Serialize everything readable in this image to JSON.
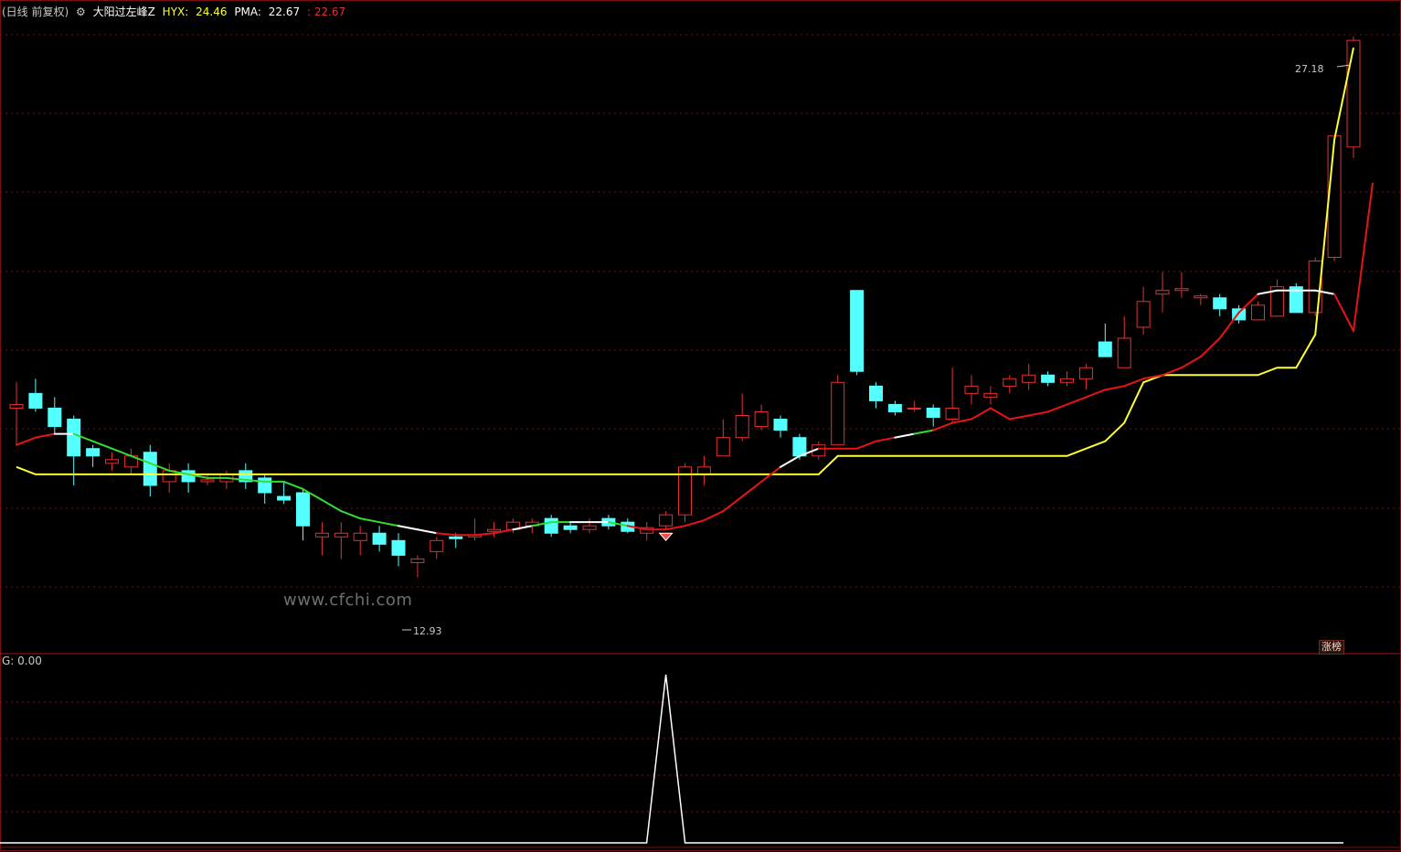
{
  "header": {
    "period": "(日线 前复权)",
    "indicator": "大阳过左峰Z",
    "hyx_label": "HYX:",
    "hyx_value": "24.46",
    "pma_label": "PMA:",
    "pma_value": "22.67",
    "pma_value2": ": 22.67"
  },
  "sub_header": {
    "label": "G: 0.00"
  },
  "badge": {
    "label": "涨榜"
  },
  "watermark": "www.cfchi.com",
  "annotations": {
    "high": "27.18",
    "low": "12.93"
  },
  "colors": {
    "up": "#e63030",
    "down": "#54ffff",
    "hyx": "#ffff33",
    "pma_up": "#e61414",
    "pma_down": "#33dd33",
    "pma_flat": "#ffffff",
    "grid": "#7a1010",
    "signal": "#ffffff"
  },
  "chart_data": {
    "type": "candlestick",
    "price_axis": {
      "min": 12.3,
      "max": 29.5
    },
    "candles": [
      {
        "o": 19.0,
        "h": 19.6,
        "l": 17.9,
        "c": 18.9,
        "dir": "up"
      },
      {
        "o": 19.3,
        "h": 19.7,
        "l": 18.8,
        "c": 18.9,
        "dir": "down"
      },
      {
        "o": 18.9,
        "h": 19.2,
        "l": 18.2,
        "c": 18.4,
        "dir": "down"
      },
      {
        "o": 18.6,
        "h": 18.7,
        "l": 16.8,
        "c": 17.6,
        "dir": "down"
      },
      {
        "o": 17.8,
        "h": 17.9,
        "l": 17.3,
        "c": 17.6,
        "dir": "down"
      },
      {
        "o": 17.4,
        "h": 17.7,
        "l": 17.2,
        "c": 17.5,
        "dir": "up"
      },
      {
        "o": 17.3,
        "h": 17.8,
        "l": 17.1,
        "c": 17.6,
        "dir": "up"
      },
      {
        "o": 17.7,
        "h": 17.9,
        "l": 16.5,
        "c": 16.8,
        "dir": "down"
      },
      {
        "o": 16.9,
        "h": 17.4,
        "l": 16.6,
        "c": 17.2,
        "dir": "up"
      },
      {
        "o": 17.2,
        "h": 17.4,
        "l": 16.6,
        "c": 16.9,
        "dir": "down"
      },
      {
        "o": 16.9,
        "h": 17.1,
        "l": 16.8,
        "c": 16.95,
        "dir": "up"
      },
      {
        "o": 16.9,
        "h": 17.2,
        "l": 16.7,
        "c": 17.1,
        "dir": "up"
      },
      {
        "o": 17.2,
        "h": 17.4,
        "l": 16.7,
        "c": 16.9,
        "dir": "down"
      },
      {
        "o": 17.0,
        "h": 17.1,
        "l": 16.3,
        "c": 16.6,
        "dir": "down"
      },
      {
        "o": 16.5,
        "h": 16.9,
        "l": 16.3,
        "c": 16.4,
        "dir": "down"
      },
      {
        "o": 16.6,
        "h": 16.7,
        "l": 15.3,
        "c": 15.7,
        "dir": "down"
      },
      {
        "o": 15.4,
        "h": 15.8,
        "l": 14.9,
        "c": 15.5,
        "dir": "up"
      },
      {
        "o": 15.5,
        "h": 15.8,
        "l": 14.8,
        "c": 15.4,
        "dir": "up"
      },
      {
        "o": 15.3,
        "h": 15.7,
        "l": 14.9,
        "c": 15.5,
        "dir": "up"
      },
      {
        "o": 15.5,
        "h": 15.7,
        "l": 15.0,
        "c": 15.2,
        "dir": "down"
      },
      {
        "o": 15.3,
        "h": 15.5,
        "l": 14.6,
        "c": 14.9,
        "dir": "down"
      },
      {
        "o": 14.7,
        "h": 14.9,
        "l": 14.3,
        "c": 14.8,
        "dir": "up"
      },
      {
        "o": 15.0,
        "h": 15.4,
        "l": 14.8,
        "c": 15.3,
        "dir": "up"
      },
      {
        "o": 15.4,
        "h": 15.5,
        "l": 15.1,
        "c": 15.35,
        "dir": "down"
      },
      {
        "o": 15.4,
        "h": 15.9,
        "l": 15.3,
        "c": 15.45,
        "dir": "up"
      },
      {
        "o": 15.55,
        "h": 15.8,
        "l": 15.4,
        "c": 15.6,
        "dir": "up"
      },
      {
        "o": 15.6,
        "h": 15.9,
        "l": 15.5,
        "c": 15.8,
        "dir": "up"
      },
      {
        "o": 15.7,
        "h": 15.9,
        "l": 15.5,
        "c": 15.8,
        "dir": "up"
      },
      {
        "o": 15.9,
        "h": 16.0,
        "l": 15.4,
        "c": 15.5,
        "dir": "down"
      },
      {
        "o": 15.7,
        "h": 15.8,
        "l": 15.5,
        "c": 15.6,
        "dir": "down"
      },
      {
        "o": 15.6,
        "h": 15.9,
        "l": 15.5,
        "c": 15.7,
        "dir": "up"
      },
      {
        "o": 15.9,
        "h": 16.0,
        "l": 15.6,
        "c": 15.7,
        "dir": "down"
      },
      {
        "o": 15.8,
        "h": 15.9,
        "l": 15.5,
        "c": 15.55,
        "dir": "down"
      },
      {
        "o": 15.5,
        "h": 15.8,
        "l": 15.3,
        "c": 15.65,
        "dir": "up"
      },
      {
        "o": 15.7,
        "h": 16.1,
        "l": 15.6,
        "c": 16.0,
        "dir": "up"
      },
      {
        "o": 16.0,
        "h": 17.4,
        "l": 15.8,
        "c": 17.3,
        "dir": "up"
      },
      {
        "o": 17.1,
        "h": 17.6,
        "l": 16.8,
        "c": 17.3,
        "dir": "up"
      },
      {
        "o": 17.6,
        "h": 18.6,
        "l": 17.6,
        "c": 18.1,
        "dir": "up"
      },
      {
        "o": 18.1,
        "h": 19.3,
        "l": 18.0,
        "c": 18.7,
        "dir": "up"
      },
      {
        "o": 18.4,
        "h": 19.0,
        "l": 18.3,
        "c": 18.8,
        "dir": "up"
      },
      {
        "o": 18.6,
        "h": 18.7,
        "l": 18.1,
        "c": 18.3,
        "dir": "down"
      },
      {
        "o": 18.1,
        "h": 18.2,
        "l": 17.5,
        "c": 17.6,
        "dir": "down"
      },
      {
        "o": 17.6,
        "h": 18.0,
        "l": 17.5,
        "c": 17.9,
        "dir": "up"
      },
      {
        "o": 17.9,
        "h": 19.8,
        "l": 17.9,
        "c": 19.6,
        "dir": "up"
      },
      {
        "o": 22.1,
        "h": 22.1,
        "l": 19.8,
        "c": 19.9,
        "dir": "down"
      },
      {
        "o": 19.5,
        "h": 19.6,
        "l": 18.9,
        "c": 19.1,
        "dir": "down"
      },
      {
        "o": 19.0,
        "h": 19.1,
        "l": 18.7,
        "c": 18.8,
        "dir": "down"
      },
      {
        "o": 18.9,
        "h": 19.1,
        "l": 18.8,
        "c": 18.9,
        "dir": "up"
      },
      {
        "o": 18.9,
        "h": 19.0,
        "l": 18.4,
        "c": 18.65,
        "dir": "down"
      },
      {
        "o": 18.6,
        "h": 20.0,
        "l": 18.5,
        "c": 18.9,
        "dir": "up"
      },
      {
        "o": 19.3,
        "h": 19.8,
        "l": 19.0,
        "c": 19.5,
        "dir": "up"
      },
      {
        "o": 19.2,
        "h": 19.5,
        "l": 19.0,
        "c": 19.3,
        "dir": "up"
      },
      {
        "o": 19.5,
        "h": 19.8,
        "l": 19.3,
        "c": 19.7,
        "dir": "up"
      },
      {
        "o": 19.6,
        "h": 20.1,
        "l": 19.4,
        "c": 19.8,
        "dir": "up"
      },
      {
        "o": 19.8,
        "h": 19.9,
        "l": 19.5,
        "c": 19.6,
        "dir": "down"
      },
      {
        "o": 19.6,
        "h": 19.9,
        "l": 19.5,
        "c": 19.7,
        "dir": "up"
      },
      {
        "o": 19.7,
        "h": 20.1,
        "l": 19.4,
        "c": 20.0,
        "dir": "up"
      },
      {
        "o": 20.7,
        "h": 21.2,
        "l": 20.3,
        "c": 20.3,
        "dir": "down"
      },
      {
        "o": 20.0,
        "h": 21.4,
        "l": 20.0,
        "c": 20.8,
        "dir": "up"
      },
      {
        "o": 21.1,
        "h": 22.2,
        "l": 20.9,
        "c": 21.8,
        "dir": "up"
      },
      {
        "o": 22.0,
        "h": 22.6,
        "l": 21.5,
        "c": 22.1,
        "dir": "up"
      },
      {
        "o": 22.1,
        "h": 22.6,
        "l": 21.9,
        "c": 22.15,
        "dir": "up"
      },
      {
        "o": 21.9,
        "h": 22.0,
        "l": 21.7,
        "c": 21.95,
        "dir": "up"
      },
      {
        "o": 21.9,
        "h": 22.0,
        "l": 21.4,
        "c": 21.6,
        "dir": "down"
      },
      {
        "o": 21.6,
        "h": 21.7,
        "l": 21.2,
        "c": 21.3,
        "dir": "down"
      },
      {
        "o": 21.3,
        "h": 21.8,
        "l": 21.3,
        "c": 21.7,
        "dir": "up"
      },
      {
        "o": 21.4,
        "h": 22.4,
        "l": 21.4,
        "c": 22.2,
        "dir": "up"
      },
      {
        "o": 22.2,
        "h": 22.3,
        "l": 21.5,
        "c": 21.5,
        "dir": "down"
      },
      {
        "o": 21.5,
        "h": 23.0,
        "l": 21.4,
        "c": 22.9,
        "dir": "up"
      },
      {
        "o": 23.0,
        "h": 26.3,
        "l": 22.9,
        "c": 26.3,
        "dir": "up"
      },
      {
        "o": 26.0,
        "h": 29.0,
        "l": 25.7,
        "c": 28.9,
        "dir": "up"
      }
    ],
    "hyx_line": [
      17.3,
      17.1,
      17.1,
      17.1,
      17.1,
      17.1,
      17.1,
      17.1,
      17.1,
      17.1,
      17.1,
      17.1,
      17.1,
      17.1,
      17.1,
      17.1,
      17.1,
      17.1,
      17.1,
      17.1,
      17.1,
      17.1,
      17.1,
      17.1,
      17.1,
      17.1,
      17.1,
      17.1,
      17.1,
      17.1,
      17.1,
      17.1,
      17.1,
      17.1,
      17.1,
      17.1,
      17.1,
      17.1,
      17.1,
      17.1,
      17.1,
      17.1,
      17.1,
      17.6,
      17.6,
      17.6,
      17.6,
      17.6,
      17.6,
      17.6,
      17.6,
      17.6,
      17.6,
      17.6,
      17.6,
      17.6,
      17.8,
      18.0,
      18.5,
      19.6,
      19.8,
      19.8,
      19.8,
      19.8,
      19.8,
      19.8,
      20.0,
      20.0,
      20.9,
      26.2,
      28.7
    ],
    "pma_line": [
      17.9,
      18.1,
      18.2,
      18.2,
      18.0,
      17.8,
      17.6,
      17.4,
      17.2,
      17.1,
      17.0,
      17.0,
      16.95,
      16.9,
      16.9,
      16.7,
      16.4,
      16.1,
      15.9,
      15.8,
      15.7,
      15.6,
      15.5,
      15.45,
      15.45,
      15.5,
      15.6,
      15.7,
      15.8,
      15.8,
      15.8,
      15.8,
      15.7,
      15.6,
      15.6,
      15.7,
      15.85,
      16.1,
      16.5,
      16.9,
      17.3,
      17.6,
      17.8,
      17.8,
      17.8,
      18.0,
      18.1,
      18.2,
      18.3,
      18.5,
      18.6,
      18.9,
      18.6,
      18.7,
      18.8,
      19.0,
      19.2,
      19.4,
      19.5,
      19.7,
      19.8,
      20.0,
      20.3,
      20.8,
      21.5,
      22.0,
      22.1,
      22.1,
      22.1,
      22.0,
      21.0,
      25.0
    ],
    "pma_color": [
      "up",
      "up",
      "up",
      "flat",
      "down",
      "down",
      "down",
      "down",
      "down",
      "down",
      "down",
      "down",
      "down",
      "down",
      "down",
      "down",
      "down",
      "down",
      "down",
      "down",
      "down",
      "flat",
      "flat",
      "up",
      "up",
      "up",
      "up",
      "flat",
      "down",
      "down",
      "flat",
      "flat",
      "down",
      "up",
      "up",
      "up",
      "up",
      "up",
      "up",
      "up",
      "up",
      "flat",
      "flat",
      "up",
      "up",
      "up",
      "up",
      "flat",
      "down",
      "up",
      "up",
      "up",
      "up",
      "up",
      "up",
      "up",
      "up",
      "up",
      "up",
      "up",
      "up",
      "up",
      "up",
      "up",
      "up",
      "up",
      "flat",
      "flat",
      "flat",
      "flat",
      "up",
      "up"
    ],
    "signal": {
      "candle_index": 34,
      "peak": 1.0
    },
    "sub_axis": {
      "min": 0,
      "max": 1
    }
  }
}
